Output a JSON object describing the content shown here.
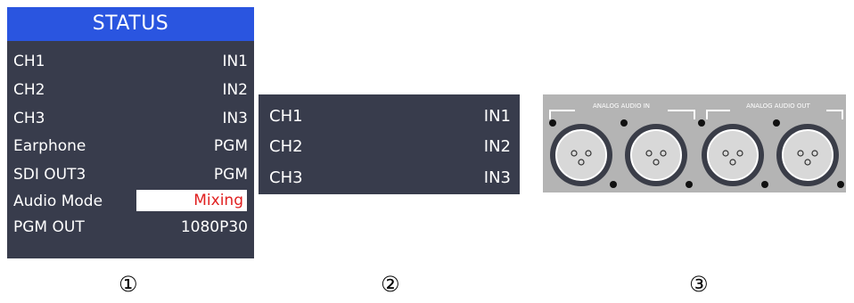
{
  "status_panel": {
    "title": "STATUS",
    "rows": [
      {
        "label": "CH1",
        "value": "IN1"
      },
      {
        "label": "CH2",
        "value": "IN2"
      },
      {
        "label": "CH3",
        "value": "IN3"
      },
      {
        "label": "Earphone",
        "value": "PGM"
      },
      {
        "label": "SDI OUT3",
        "value": "PGM"
      },
      {
        "label": "Audio Mode",
        "value": "Mixing"
      },
      {
        "label": "PGM OUT",
        "value": "1080P30"
      }
    ]
  },
  "channel_panel": {
    "rows": [
      {
        "label": "CH1",
        "value": "IN1"
      },
      {
        "label": "CH2",
        "value": "IN2"
      },
      {
        "label": "CH3",
        "value": "IN3"
      }
    ]
  },
  "audio_panel": {
    "analog_in_label": "ANALOG AUDIO IN",
    "analog_out_label": "ANALOG AUDIO OUT"
  },
  "figure_labels": [
    "①",
    "②",
    "③"
  ],
  "colors": {
    "panel_bg": "#383c4c",
    "header_bg": "#2a55e0",
    "highlight_text": "#e02020",
    "connector_panel": "#b4b4b4"
  }
}
